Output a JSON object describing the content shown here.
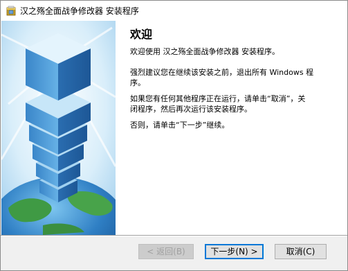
{
  "window": {
    "title": "汉之殇全面战争修改器 安装程序",
    "icon": "installer-icon"
  },
  "welcome": {
    "heading": "欢迎",
    "paragraph1": "欢迎使用 汉之殇全面战争修改器  安装程序。",
    "paragraph2": "强烈建议您在继续该安装之前，退出所有 Windows 程\n序。",
    "paragraph3": "如果您有任何其他程序正在运行，请单击“取消”，关\n闭程序，然后再次运行该安装程序。",
    "paragraph4": "否则，请单击“下一步”继续。"
  },
  "buttons": {
    "back": "< 返回(B)",
    "next": "下一步(N) >",
    "cancel": "取消(C)"
  },
  "colors": {
    "accent": "#0078d7",
    "sky": "#cfe8f8",
    "globe": "#2f8a3a"
  }
}
